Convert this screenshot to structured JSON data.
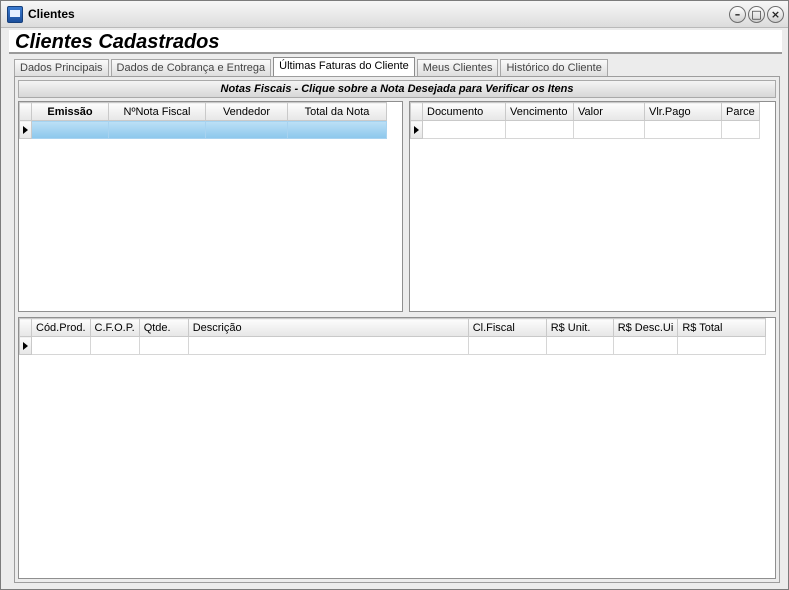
{
  "window": {
    "title": "Clientes",
    "controls": {
      "minimize": "–",
      "maximize": "□",
      "close": "×"
    }
  },
  "header": {
    "title": "Clientes Cadastrados"
  },
  "tabs": [
    {
      "label": "Dados Principais",
      "active": false
    },
    {
      "label": "Dados de Cobrança e Entrega",
      "active": false
    },
    {
      "label": "Últimas Faturas do Cliente",
      "active": true
    },
    {
      "label": "Meus Clientes",
      "active": false
    },
    {
      "label": "Histórico do Cliente",
      "active": false
    }
  ],
  "section": {
    "banner": "Notas Fiscais - Clique sobre a Nota Desejada para Verificar os Itens"
  },
  "invoices_table": {
    "columns": [
      "Emissão",
      "NºNota Fiscal",
      "Vendedor",
      "Total da Nota"
    ]
  },
  "installments_table": {
    "columns": [
      "Documento",
      "Vencimento",
      "Valor",
      "Vlr.Pago",
      "Parce"
    ]
  },
  "items_table": {
    "columns": [
      "Cód.Prod.",
      "C.F.O.P.",
      "Qtde.",
      "Descrição",
      "Cl.Fiscal",
      "R$ Unit.",
      "R$ Desc.Ui",
      "R$ Total"
    ]
  }
}
